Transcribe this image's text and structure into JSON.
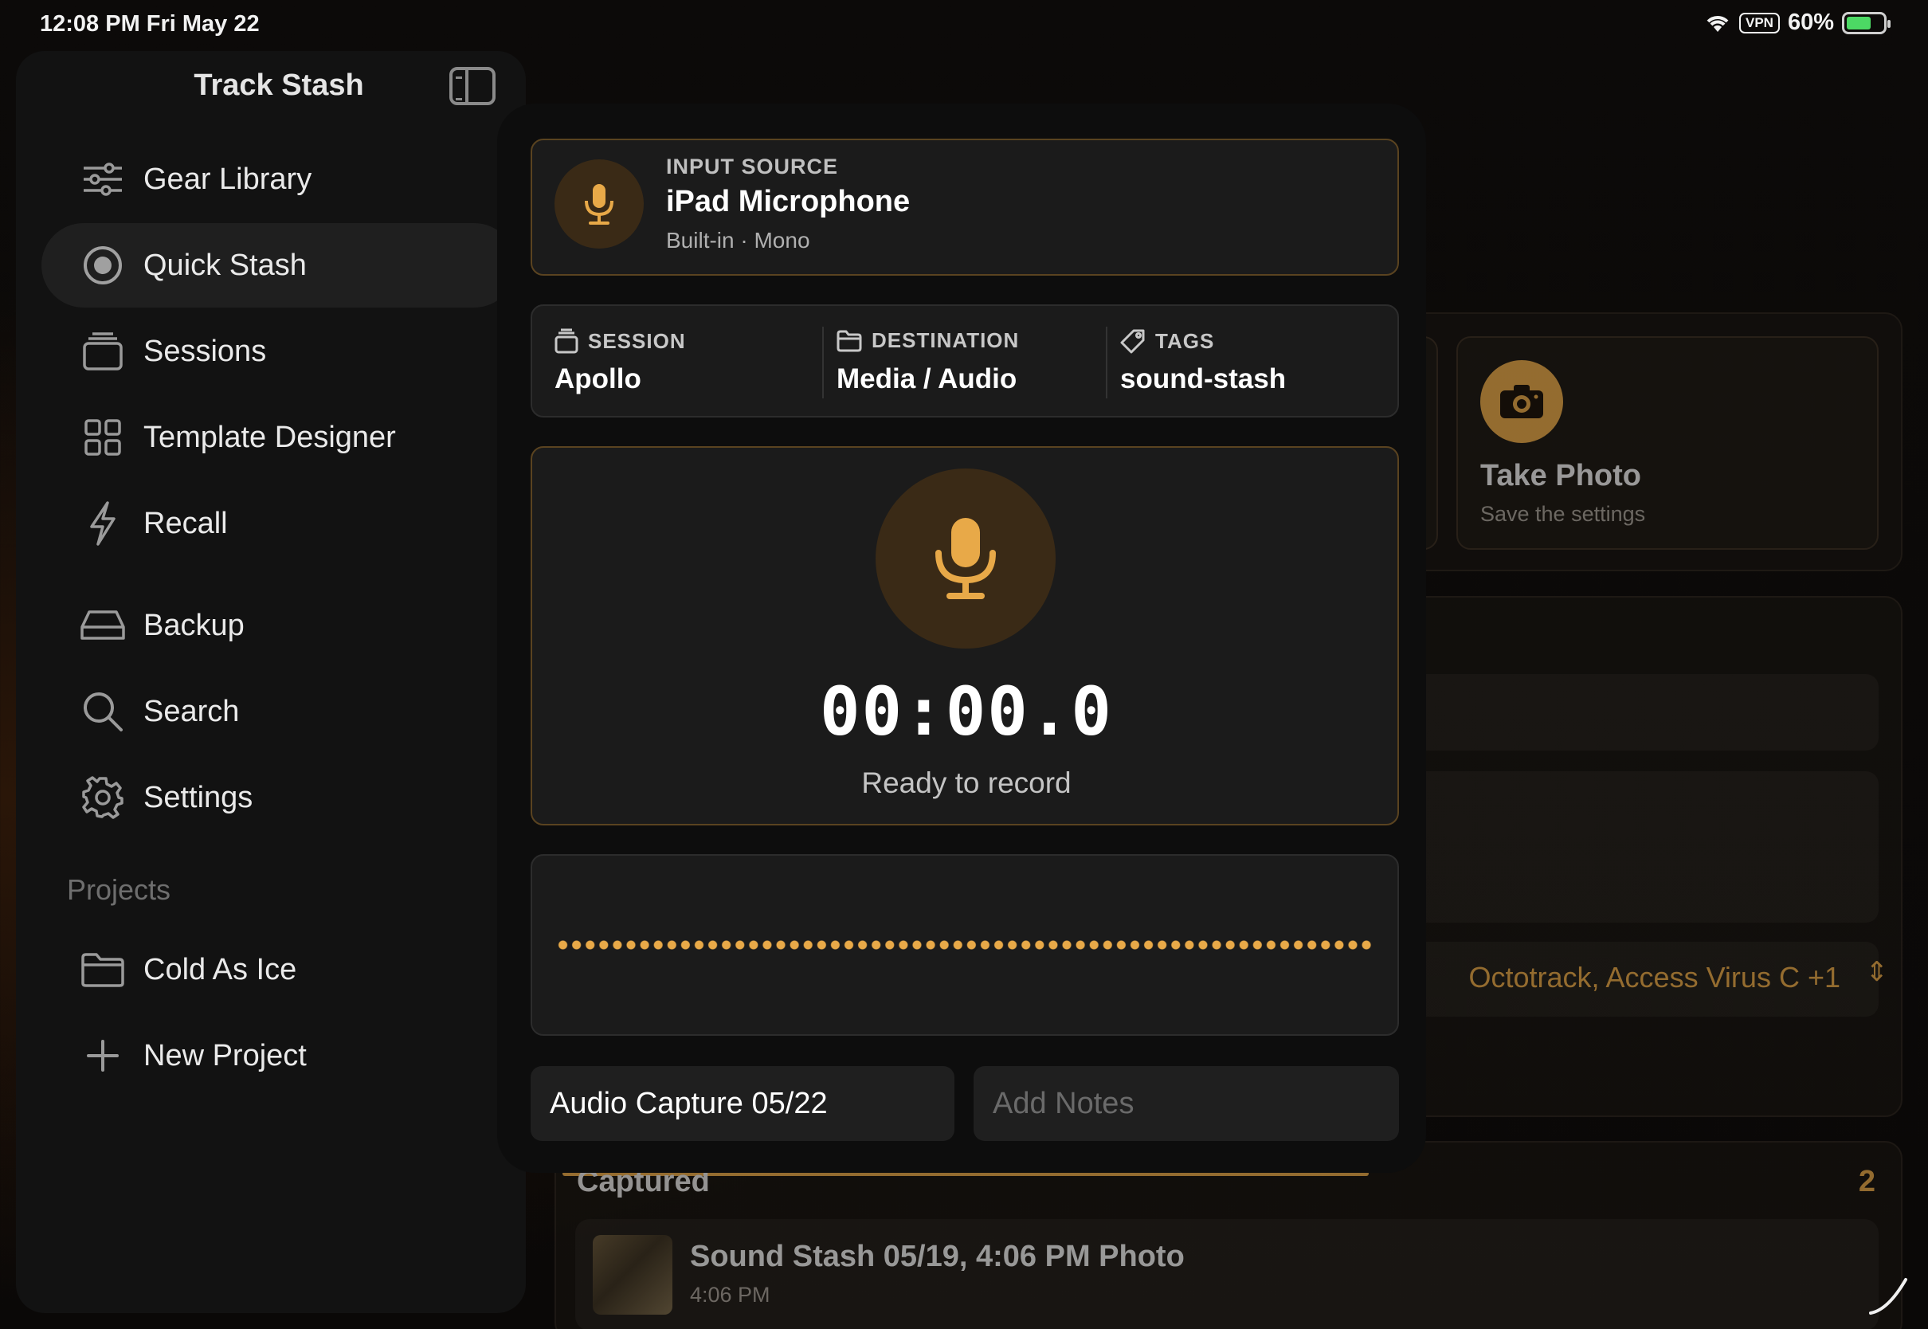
{
  "status_bar": {
    "time_date": "12:08 PM   Fri May 22",
    "vpn": "VPN",
    "battery": "60%",
    "battery_level": 0.6
  },
  "sidebar": {
    "title": "Track Stash",
    "items": [
      {
        "label": "Gear Library",
        "icon": "sliders-icon"
      },
      {
        "label": "Quick Stash",
        "icon": "record-icon",
        "active": true
      },
      {
        "label": "Sessions",
        "icon": "stack-icon"
      },
      {
        "label": "Template Designer",
        "icon": "grid-icon"
      },
      {
        "label": "Recall",
        "icon": "bolt-icon"
      },
      {
        "label": "Backup",
        "icon": "drive-icon"
      },
      {
        "label": "Search",
        "icon": "search-icon"
      },
      {
        "label": "Settings",
        "icon": "gear-icon"
      }
    ],
    "projects_header": "Projects",
    "projects": [
      {
        "label": "Cold As Ice",
        "icon": "folder-icon"
      },
      {
        "label": "New Project",
        "icon": "plus-icon"
      }
    ]
  },
  "background": {
    "photo_card": {
      "title": "Take Photo",
      "subtitle": "Save the settings"
    },
    "gear_selector": "Octotrack, Access Virus C +1",
    "captured": {
      "title": "Captured",
      "count": "2",
      "items": [
        {
          "title": "Sound Stash 05/19, 4:06 PM Photo",
          "time": "4:06 PM"
        }
      ]
    }
  },
  "recorder": {
    "input_source": {
      "kicker": "INPUT SOURCE",
      "name": "iPad Microphone",
      "detail": "Built-in · Mono"
    },
    "meta": {
      "session_label": "SESSION",
      "session_value": "Apollo",
      "destination_label": "DESTINATION",
      "destination_value": "Media / Audio",
      "tags_label": "TAGS",
      "tags_value": "sound-stash"
    },
    "timer": "00:00.0",
    "status": "Ready to record",
    "title_value": "Audio Capture 05/22",
    "notes_placeholder": "Add Notes"
  },
  "colors": {
    "accent": "#e8a948",
    "accent_dark": "#3a2a16",
    "card": "#1b1b1b",
    "sidebar": "#121212"
  }
}
